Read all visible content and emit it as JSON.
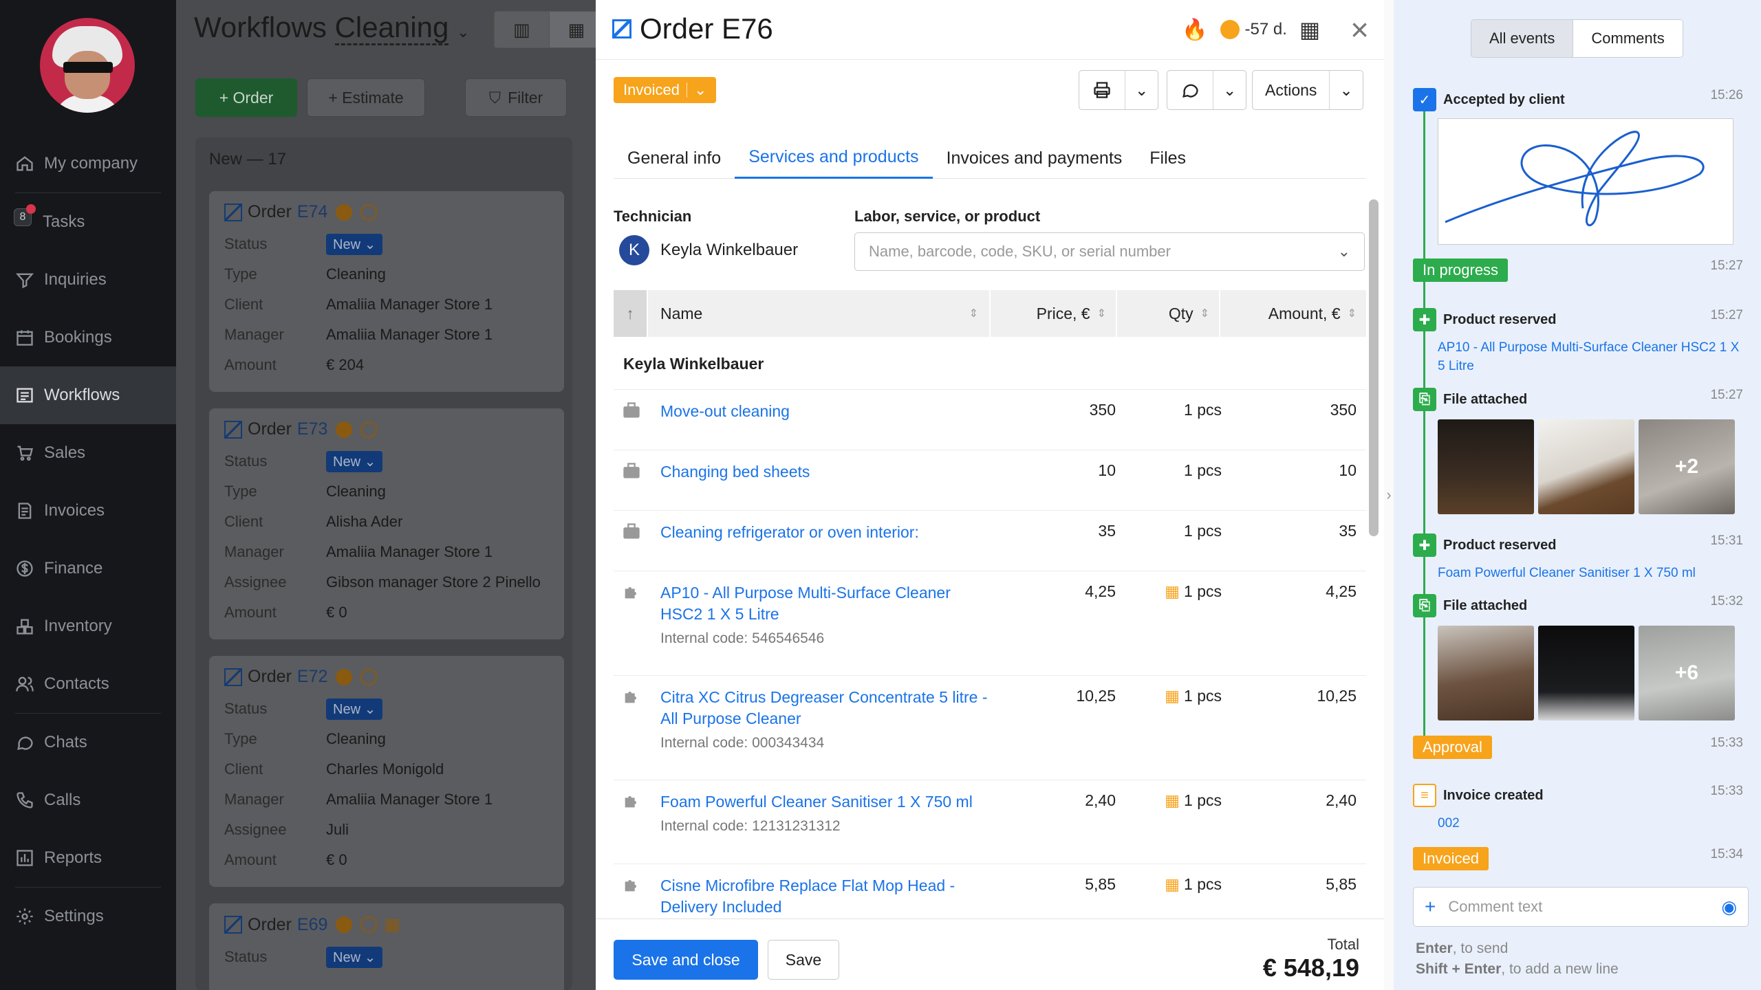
{
  "sidebar": {
    "items": [
      {
        "label": "My company",
        "icon": "home-icon"
      },
      {
        "label": "Tasks",
        "icon": "tasks-icon",
        "badge": "8"
      },
      {
        "label": "Inquiries",
        "icon": "funnel-icon"
      },
      {
        "label": "Bookings",
        "icon": "calendar-icon"
      },
      {
        "label": "Workflows",
        "icon": "workflow-icon",
        "active": true
      },
      {
        "label": "Sales",
        "icon": "cart-icon"
      },
      {
        "label": "Invoices",
        "icon": "invoice-icon"
      },
      {
        "label": "Finance",
        "icon": "dollar-icon"
      },
      {
        "label": "Inventory",
        "icon": "boxes-icon"
      },
      {
        "label": "Contacts",
        "icon": "contacts-icon"
      },
      {
        "label": "Chats",
        "icon": "chat-icon"
      },
      {
        "label": "Calls",
        "icon": "phone-icon"
      },
      {
        "label": "Reports",
        "icon": "reports-icon"
      },
      {
        "label": "Settings",
        "icon": "gear-icon"
      }
    ]
  },
  "board": {
    "title": "Workflows",
    "pipeline": "Cleaning",
    "btn_order": "+ Order",
    "btn_estimate": "+ Estimate",
    "btn_filter": "Filter",
    "column": "New — 17",
    "labels": {
      "status": "Status",
      "type": "Type",
      "client": "Client",
      "manager": "Manager",
      "assignee": "Assignee",
      "amount": "Amount"
    },
    "cards": [
      {
        "prefix": "Order",
        "num": "E74",
        "status": "New",
        "type": "Cleaning",
        "client": "Amaliia Manager Store 1",
        "manager": "Amaliia Manager Store 1",
        "amount": "€ 204"
      },
      {
        "prefix": "Order",
        "num": "E73",
        "status": "New",
        "type": "Cleaning",
        "client": "Alisha Ader",
        "manager": "Amaliia Manager Store 1",
        "assignee": "Gibson manager Store 2 Pinello",
        "amount": "€ 0"
      },
      {
        "prefix": "Order",
        "num": "E72",
        "status": "New",
        "type": "Cleaning",
        "client": "Charles Monigold",
        "manager": "Amaliia Manager Store 1",
        "assignee": "Juli",
        "amount": "€ 0"
      },
      {
        "prefix": "Order",
        "num": "E69",
        "status": "New"
      }
    ]
  },
  "order": {
    "title": "Order E76",
    "overdue": "-57 d.",
    "status": "Invoiced",
    "actions": "Actions",
    "tabs": [
      "General info",
      "Services and products",
      "Invoices and payments",
      "Files"
    ],
    "technician_label": "Technician",
    "technician_initial": "K",
    "technician": "Keyla Winkelbauer",
    "product_label": "Labor, service, or product",
    "product_placeholder": "Name, barcode, code, SKU, or serial number",
    "columns": {
      "name": "Name",
      "price": "Price, €",
      "qty": "Qty",
      "amount": "Amount, €"
    },
    "group": "Keyla Winkelbauer",
    "lines": [
      {
        "name": "Move-out cleaning",
        "price": "350",
        "qty": "1 pcs",
        "amount": "350",
        "kind": "service"
      },
      {
        "name": "Changing bed sheets",
        "price": "10",
        "qty": "1 pcs",
        "amount": "10",
        "kind": "service"
      },
      {
        "name": "Cleaning refrigerator or oven interior:",
        "price": "35",
        "qty": "1 pcs",
        "amount": "35",
        "kind": "service"
      },
      {
        "name": "AP10 - All Purpose Multi-Surface Cleaner HSC2 1 X 5 Litre",
        "code": "Internal code: 546546546",
        "price": "4,25",
        "qty": "1 pcs",
        "amount": "4,25",
        "kind": "product"
      },
      {
        "name": "Citra XC Citrus Degreaser Concentrate 5 litre - All Purpose Cleaner",
        "code": "Internal code: 000343434",
        "price": "10,25",
        "qty": "1 pcs",
        "amount": "10,25",
        "kind": "product"
      },
      {
        "name": "Foam Powerful Cleaner Sanitiser 1 X 750 ml",
        "code": "Internal code: 12131231312",
        "price": "2,40",
        "qty": "1 pcs",
        "amount": "2,40",
        "kind": "product"
      },
      {
        "name": "Cisne Microfibre Replace Flat Mop Head - Delivery Included",
        "price": "5,85",
        "qty": "1 pcs",
        "amount": "5,85",
        "kind": "product"
      }
    ],
    "save_close": "Save and close",
    "save": "Save",
    "total_label": "Total",
    "total": "€ 548,19"
  },
  "events": {
    "tabs": [
      "All events",
      "Comments"
    ],
    "items": [
      {
        "title": "Accepted by client",
        "time": "15:26"
      },
      {
        "pill": "In progress",
        "time": "15:27",
        "color": "#2cac4c"
      },
      {
        "title": "Product reserved",
        "time": "15:27",
        "detail": "AP10 - All Purpose Multi-Surface Cleaner HSC2 1 X 5 Litre"
      },
      {
        "title": "File attached",
        "time": "15:27",
        "more": "+2"
      },
      {
        "title": "Product reserved",
        "time": "15:31",
        "detail": "Foam Powerful Cleaner Sanitiser 1 X 750 ml"
      },
      {
        "title": "File attached",
        "time": "15:32",
        "more": "+6"
      },
      {
        "pill": "Approval",
        "time": "15:33",
        "color": "#f7a31b"
      },
      {
        "title": "Invoice created",
        "time": "15:33",
        "detail": "002"
      },
      {
        "pill": "Invoiced",
        "time": "15:34",
        "color": "#f7a31b"
      }
    ],
    "comment_placeholder": "Comment text",
    "hint1_key": "Enter",
    "hint1": ", to send",
    "hint2_key": "Shift + Enter",
    "hint2": ", to add a new line"
  },
  "colors": {
    "primary": "#1a73e8",
    "success": "#2cac4c",
    "warning": "#f7a31b"
  }
}
